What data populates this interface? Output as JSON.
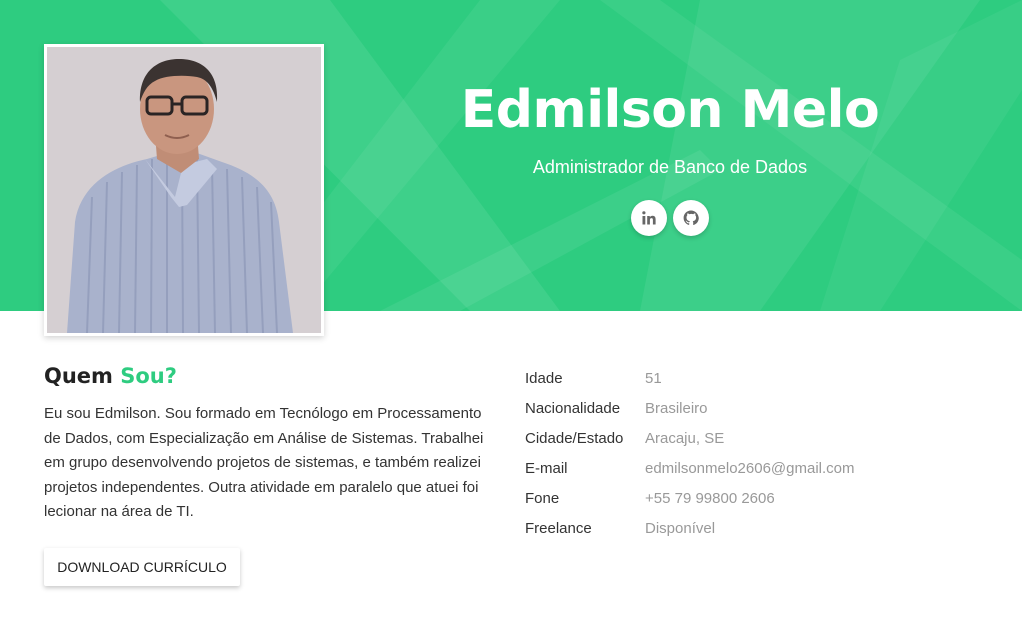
{
  "profile": {
    "name": "Edmilson Melo",
    "role": "Administrador de Banco de Dados",
    "photo_alt": "Edmilson Melo"
  },
  "social": [
    {
      "icon": "linkedin-icon",
      "label": "in"
    },
    {
      "icon": "github-icon",
      "label": "github"
    }
  ],
  "about": {
    "title_prefix": "Quem",
    "title_accent": "Sou?",
    "text": "Eu sou Edmilson. Sou formado em Tecnólogo em Processamento de Dados, com Especialização em Análise de Sistemas. Trabalhei em grupo desenvolvendo projetos de sistemas, e também realizei projetos independentes. Outra atividade em paralelo que atuei foi lecionar na área de TI.",
    "download_label": "Download Currículo"
  },
  "info": [
    {
      "label": "Idade",
      "value": "51"
    },
    {
      "label": "Nacionalidade",
      "value": "Brasileiro"
    },
    {
      "label": "Cidade/Estado",
      "value": "Aracaju, SE"
    },
    {
      "label": "E-mail",
      "value": "edmilsonmelo2606@gmail.com"
    },
    {
      "label": "Fone",
      "value": "+55 79 99800 2606"
    },
    {
      "label": "Freelance",
      "value": "Disponível"
    }
  ],
  "colors": {
    "accent": "#2ecc80",
    "text": "#333333",
    "muted": "#999999"
  }
}
